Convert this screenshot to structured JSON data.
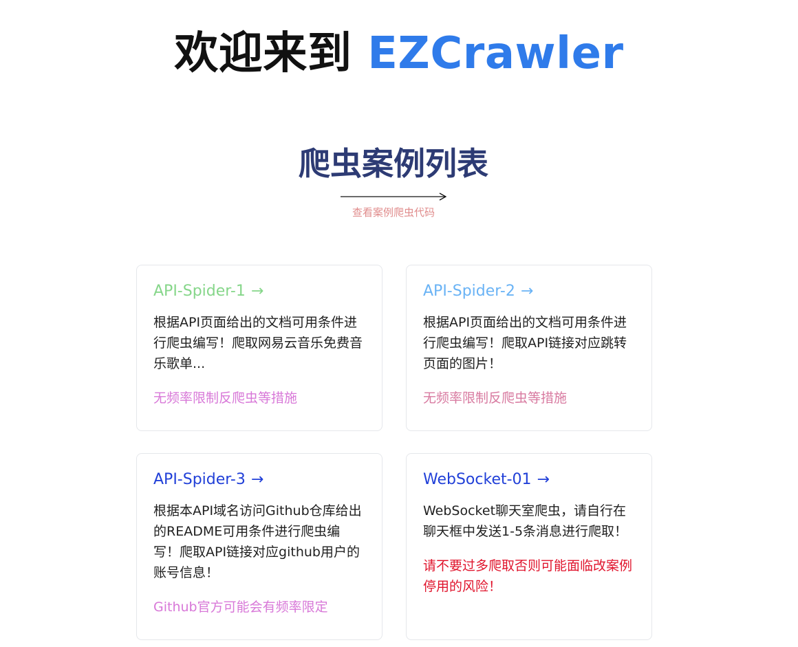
{
  "header": {
    "title_prefix": "欢迎来到",
    "title_brand": "EZCrawler"
  },
  "section": {
    "title": "爬虫案例列表",
    "code_link": "查看案例爬虫代码"
  },
  "colors": {
    "brand_blue": "#2f7bea",
    "section_title": "#2d3b74",
    "code_link": "#e08c8c",
    "green": "#86d68a",
    "light_blue": "#6ab3f5",
    "deep_blue": "#2140d8",
    "pink_purple": "#d878d8",
    "pink": "#d87aa0",
    "red": "#e0142c"
  },
  "cards": [
    {
      "title": "API-Spider-1",
      "arrow": "→",
      "description": "根据API页面给出的文档可用条件进行爬虫编写！爬取网易云音乐免费音乐歌单...",
      "note": "无频率限制反爬虫等措施"
    },
    {
      "title": "API-Spider-2",
      "arrow": "→",
      "description": "根据API页面给出的文档可用条件进行爬虫编写！爬取API链接对应跳转页面的图片！",
      "note": "无频率限制反爬虫等措施"
    },
    {
      "title": "API-Spider-3",
      "arrow": "→",
      "description": "根据本API域名访问Github仓库给出的README可用条件进行爬虫编写！爬取API链接对应github用户的账号信息！",
      "note": "Github官方可能会有频率限定"
    },
    {
      "title": "WebSocket-01",
      "arrow": "→",
      "description": "WebSocket聊天室爬虫，请自行在聊天框中发送1-5条消息进行爬取！",
      "note": "请不要过多爬取否则可能面临改案例停用的风险！"
    }
  ]
}
